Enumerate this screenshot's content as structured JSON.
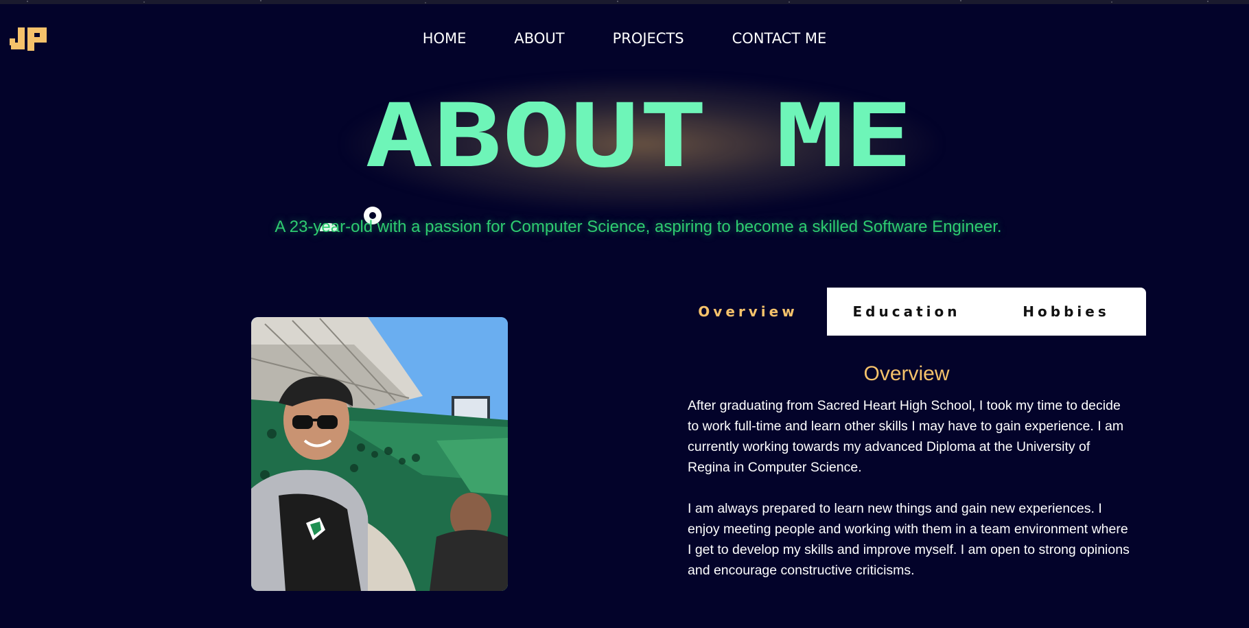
{
  "header": {
    "logo_text": "JP",
    "nav": [
      {
        "label": "HOME"
      },
      {
        "label": "ABOUT"
      },
      {
        "label": "PROJECTS"
      },
      {
        "label": "CONTACT ME"
      }
    ]
  },
  "hero": {
    "title": "ABOUT ME",
    "subtitle": "A 23-year-old with a passion for Computer Science, aspiring to become a skilled Software Engineer."
  },
  "tabs": [
    {
      "label": "Overview",
      "active": true
    },
    {
      "label": "Education",
      "active": false
    },
    {
      "label": "Hobbies",
      "active": false
    }
  ],
  "content": {
    "title": "Overview",
    "paragraphs": [
      "After graduating from Sacred Heart High School, I took my time to decide to work full-time and learn other skills I may have to gain experience. I am currently working towards my advanced Diploma at the University of Regina in Computer Science.",
      "I am always prepared to learn new things and gain new experiences. I enjoy meeting people and working with them in a team environment where I get to develop my skills and improve myself. I am open to strong opinions and encourage constructive criticisms."
    ]
  },
  "colors": {
    "background": "#03032a",
    "accent_gold": "#f5c26b",
    "title_green": "#6ef5b8",
    "subtitle_green": "#2ecc71"
  },
  "icons": {
    "logo": "jp-monogram-logo",
    "cursor": "cursor-icon"
  }
}
